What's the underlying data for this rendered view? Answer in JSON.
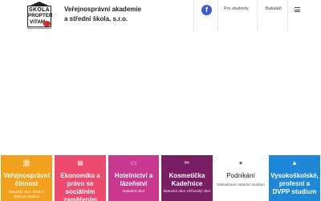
{
  "header": {
    "logo_text": [
      "ŠKOLA",
      "PROPTER",
      "VITAM"
    ],
    "title_line1": "Veřejnosprávní akademie",
    "title_line2": "a střední škola, s.r.o.",
    "facebook_glyph": "f",
    "nav_students": "Pro studenty",
    "nav_bakalari": "Bakaláři",
    "menu_icon": "hamburger-icon"
  },
  "tiles": [
    {
      "title": "Veřejnosprávní činnost",
      "subtitle": "Maturitní obor. Denní i dálkové studium",
      "icon": "bank-icon",
      "color": "#f2a11c"
    },
    {
      "title": "Ekonomika a právo se sociálním zaměřením",
      "subtitle": "",
      "icon": "folder-icon",
      "color": "#ee4a6e"
    },
    {
      "title": "Hotelnictví a lázeňství",
      "subtitle": "Maturitní obor",
      "icon": "bed-icon",
      "color": "#c8388e"
    },
    {
      "title": "Kosmetička Kadeřnice",
      "subtitle": "Maturitní obor Učňovský obor",
      "icon": "scissors-icon",
      "color": "#7a1e63"
    },
    {
      "title": "Podnikání",
      "subtitle": "Nástavbové maturitní studium",
      "icon": "person-icon",
      "color": "#ffffff"
    },
    {
      "title": "Vysokoškolské, profesní a DVPP studium",
      "subtitle": "",
      "icon": "graduation-cap-icon",
      "color": "#1e87d8"
    }
  ]
}
